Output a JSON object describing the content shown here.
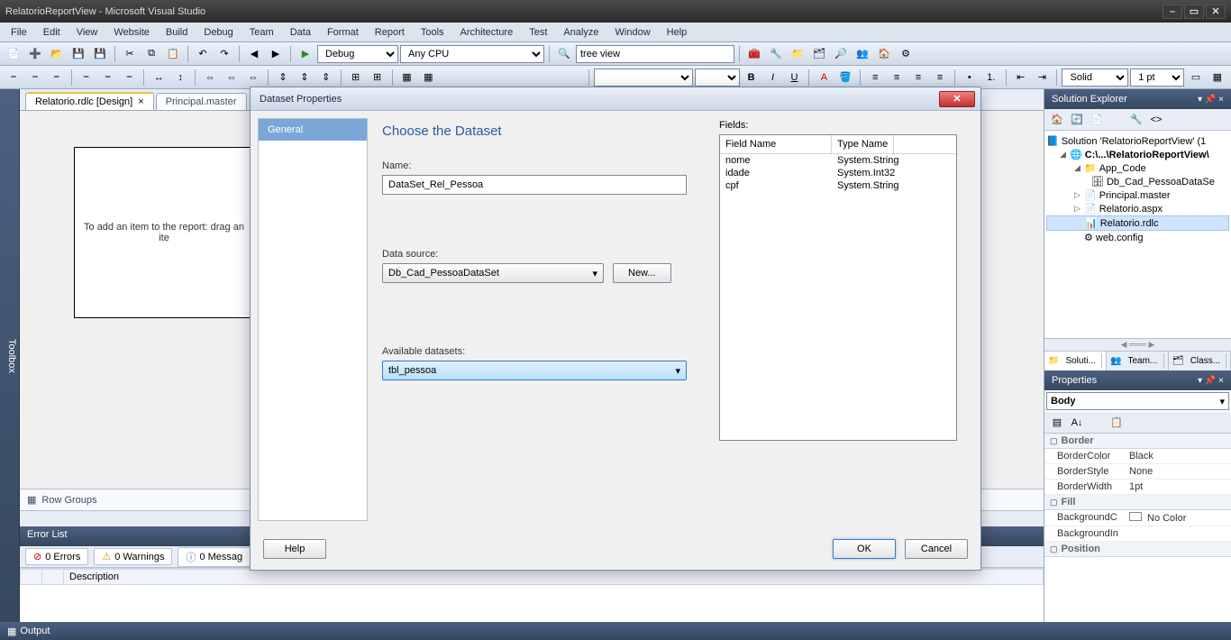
{
  "window_title": "RelatorioReportView - Microsoft Visual Studio",
  "menu": [
    "File",
    "Edit",
    "View",
    "Website",
    "Build",
    "Debug",
    "Team",
    "Data",
    "Format",
    "Report",
    "Tools",
    "Architecture",
    "Test",
    "Analyze",
    "Window",
    "Help"
  ],
  "toolbar1": {
    "config": "Debug",
    "platform": "Any CPU",
    "search": "tree view"
  },
  "toolbar2": {
    "border_style": "Solid",
    "border_width": "1 pt"
  },
  "doc_tabs": [
    {
      "label": "Relatorio.rdlc [Design]",
      "active": true
    },
    {
      "label": "Principal.master",
      "active": false
    }
  ],
  "report_body_hint": "To add an item to the report: drag an ite",
  "row_groups_label": "Row Groups",
  "error_list": {
    "title": "Error List",
    "errors": "0 Errors",
    "warnings": "0 Warnings",
    "messages": "0 Messag",
    "col_description": "Description"
  },
  "output_label": "Output",
  "solution_explorer": {
    "title": "Solution Explorer",
    "root": "Solution 'RelatorioReportView' (1",
    "project": "C:\\...\\RelatorioReportView\\",
    "app_code": "App_Code",
    "dataset_file": "Db_Cad_PessoaDataSe",
    "items": [
      "Principal.master",
      "Relatorio.aspx",
      "Relatorio.rdlc",
      "web.config"
    ]
  },
  "bottom_tabs": [
    "Soluti...",
    "Team...",
    "Class..."
  ],
  "properties": {
    "title": "Properties",
    "target": "Body",
    "cats": {
      "border": "Border",
      "fill": "Fill",
      "position": "Position"
    },
    "rows": [
      {
        "k": "BorderColor",
        "v": "Black"
      },
      {
        "k": "BorderStyle",
        "v": "None"
      },
      {
        "k": "BorderWidth",
        "v": "1pt"
      },
      {
        "k": "BackgroundC",
        "v": "No Color"
      },
      {
        "k": "BackgroundIn",
        "v": ""
      }
    ]
  },
  "dialog": {
    "title": "Dataset Properties",
    "sidebar": [
      "General"
    ],
    "heading": "Choose the Dataset",
    "name_label": "Name:",
    "name_value": "DataSet_Rel_Pessoa",
    "datasource_label": "Data source:",
    "datasource_value": "Db_Cad_PessoaDataSet",
    "new_btn": "New...",
    "avail_label": "Available datasets:",
    "avail_value": "tbl_pessoa",
    "fields_label": "Fields:",
    "fields_cols": [
      "Field Name",
      "Type Name"
    ],
    "fields": [
      {
        "name": "nome",
        "type": "System.String"
      },
      {
        "name": "idade",
        "type": "System.Int32"
      },
      {
        "name": "cpf",
        "type": "System.String"
      }
    ],
    "help": "Help",
    "ok": "OK",
    "cancel": "Cancel"
  },
  "toolbox_label": "Toolbox"
}
